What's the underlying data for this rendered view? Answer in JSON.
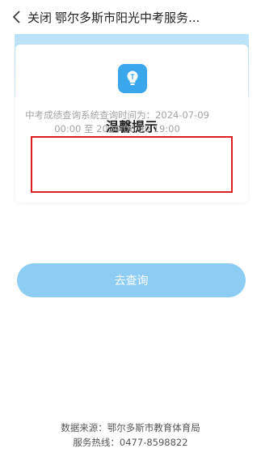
{
  "header": {
    "back_glyph": "〈",
    "close_label": "关闭",
    "title": "鄂尔多斯市阳光中考服务..."
  },
  "card": {
    "title": "温馨提示",
    "notice": "中考成绩查询系统查询时间为：2024-07-09 00:00 至 2024-08-30 19:00",
    "icon": "lightbulb-icon",
    "highlight_color": "#e02020"
  },
  "action": {
    "label": "去查询",
    "color": "#8dcdf4"
  },
  "footer": {
    "source": "数据来源：鄂尔多斯市教育体育局",
    "hotline": "服务热线：0477-8598822"
  }
}
